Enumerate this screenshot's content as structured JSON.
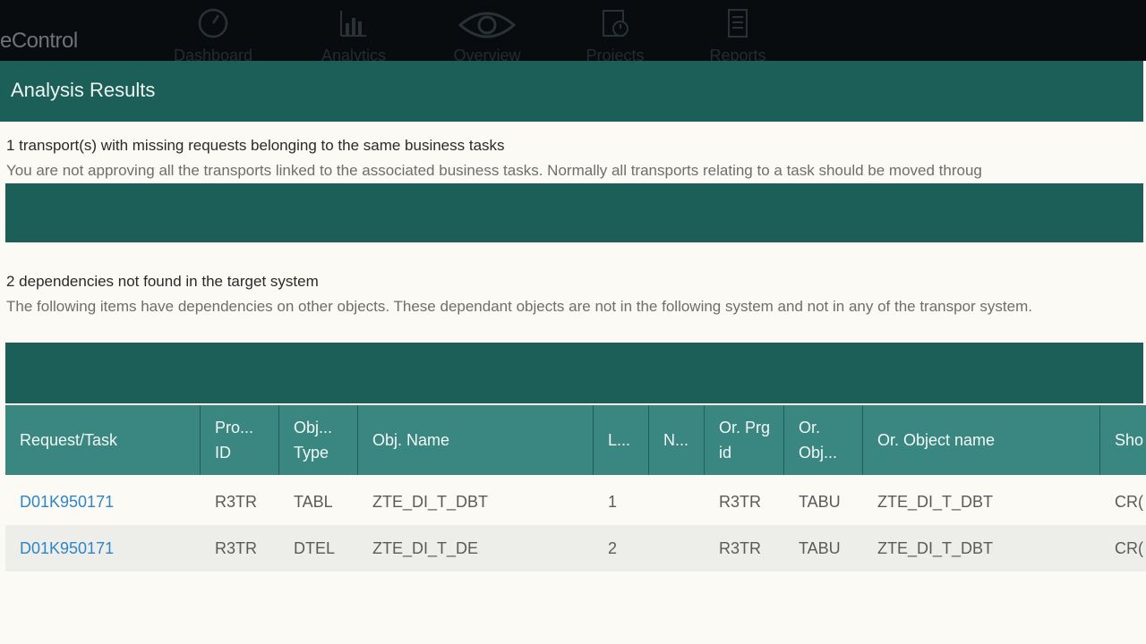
{
  "brand": "eControl",
  "nav": [
    {
      "label": "Dashboard",
      "icon": "dashboard-gauge-icon"
    },
    {
      "label": "Analytics",
      "icon": "analytics-chart-icon"
    },
    {
      "label": "Overview",
      "icon": "overview-eye-icon"
    },
    {
      "label": "Projects",
      "icon": "projects-clock-icon"
    },
    {
      "label": "Reports",
      "icon": "reports-document-icon"
    }
  ],
  "title": "Analysis Results",
  "section1": {
    "title": "1 transport(s) with missing requests belonging to the same business tasks",
    "desc": "You are not approving all the transports linked to the associated business tasks. Normally all transports relating to a task should be moved throug"
  },
  "section2": {
    "title": "2 dependencies not found in the target system",
    "desc": "The following items have dependencies on other objects. These dependant objects are not in the following system and not in any of the transpor system."
  },
  "table": {
    "headers": [
      "Request/Task",
      "Pro... ID",
      "Obj... Type",
      "Obj. Name",
      "L...",
      "N...",
      "Or. Prg id",
      "Or. Obj...",
      "Or. Object name",
      "Sho"
    ],
    "rows": [
      [
        "D01K950171",
        "R3TR",
        "TABL",
        "ZTE_DI_T_DBT",
        "1",
        "",
        "R3TR",
        "TABU",
        "ZTE_DI_T_DBT",
        "CR("
      ],
      [
        "D01K950171",
        "R3TR",
        "DTEL",
        "ZTE_DI_T_DE",
        "2",
        "",
        "R3TR",
        "TABU",
        "ZTE_DI_T_DBT",
        "CR("
      ]
    ]
  },
  "colors": {
    "accent": "#1b5f58",
    "header": "#3a8782",
    "link": "#2f86c4"
  }
}
